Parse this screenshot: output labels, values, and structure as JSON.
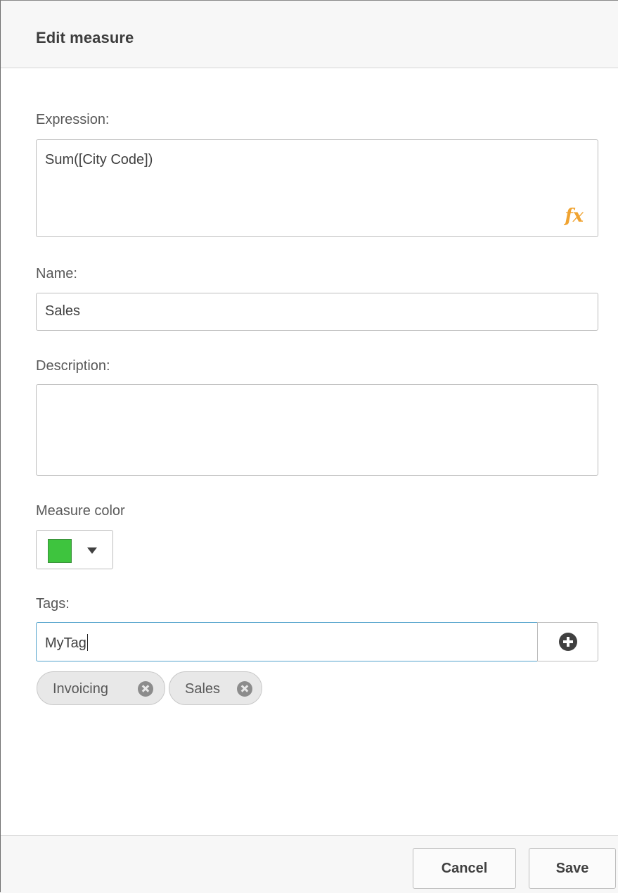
{
  "dialog": {
    "title": "Edit measure"
  },
  "expression": {
    "label": "Expression:",
    "value": "Sum([City Code])",
    "function_icon": "fx-icon"
  },
  "name": {
    "label": "Name:",
    "value": "Sales"
  },
  "description": {
    "label": "Description:",
    "value": ""
  },
  "measure_color": {
    "label": "Measure color",
    "color": "#3ec43e"
  },
  "tags": {
    "label": "Tags:",
    "input_value": "MyTag",
    "add_icon": "plus-circle-icon",
    "items": [
      {
        "label": "Invoicing"
      },
      {
        "label": "Sales"
      }
    ]
  },
  "footer": {
    "cancel_label": "Cancel",
    "save_label": "Save"
  },
  "colors": {
    "accent_focus": "#52a2cc",
    "fx": "#f0a330"
  }
}
